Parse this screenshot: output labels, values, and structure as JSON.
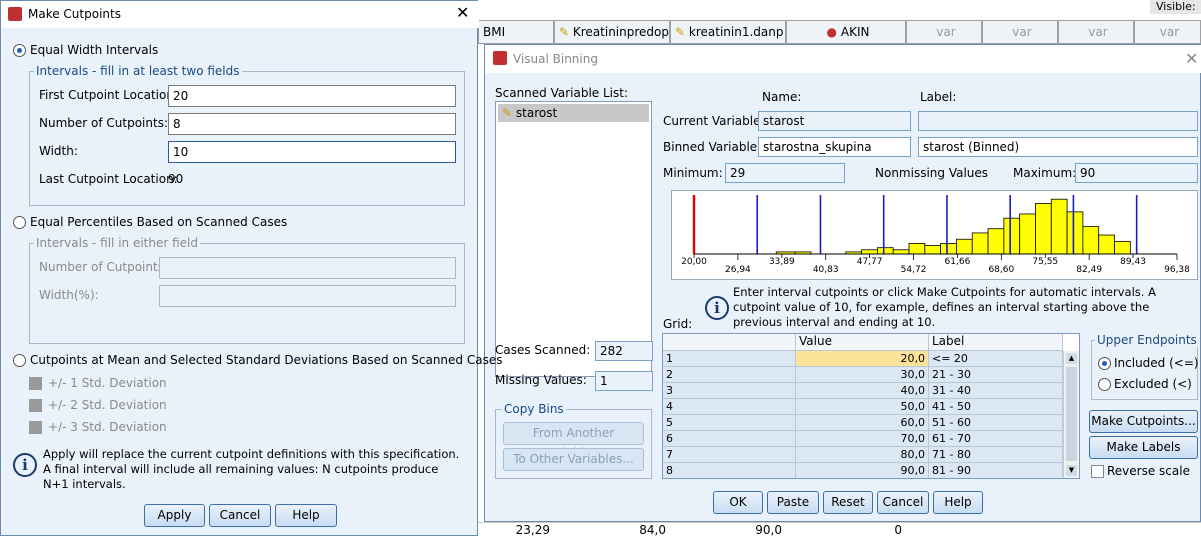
{
  "background": {
    "visible_label": "Visible:",
    "columns": [
      "BMI",
      "Kreatininpredop",
      "kreatinin1.danp",
      "AKIN",
      "var",
      "var",
      "var",
      "var"
    ],
    "bottom_row": [
      "23,29",
      "84,0",
      "90,0",
      "0"
    ]
  },
  "make_cutpoints": {
    "title": "Make Cutpoints",
    "equal_width": {
      "label": "Equal Width Intervals",
      "group_title": "Intervals - fill in at least two fields",
      "first_label": "First Cutpoint Location:",
      "first_value": "20",
      "number_label": "Number of Cutpoints:",
      "number_value": "8",
      "width_label": "Width:",
      "width_value": "10",
      "last_label": "Last Cutpoint Location:",
      "last_value": "90"
    },
    "equal_percentiles": {
      "label": "Equal Percentiles Based on Scanned Cases",
      "group_title": "Intervals - fill in either field",
      "number_label": "Number of Cutpoints:",
      "width_label": "Width(%):"
    },
    "mean_sd": {
      "label": "Cutpoints at Mean and Selected Standard Deviations Based on Scanned Cases",
      "sd1": "+/- 1 Std. Deviation",
      "sd2": "+/- 2 Std. Deviation",
      "sd3": "+/- 3 Std. Deviation"
    },
    "info_text": "Apply will replace the current cutpoint definitions with this specification. A final interval will include all remaining values: N cutpoints produce N+1 intervals.",
    "buttons": {
      "apply": "Apply",
      "cancel": "Cancel",
      "help": "Help"
    }
  },
  "visual_binning": {
    "title": "Visual Binning",
    "scanned_list_label": "Scanned Variable List:",
    "scanned_item": "starost",
    "name_label": "Name:",
    "label_label": "Label:",
    "current_variable_label": "Current Variable:",
    "current_variable_value": "starost",
    "current_variable_desc": "",
    "binned_variable_label": "Binned Variable:",
    "binned_variable_value": "starostna_skupina",
    "binned_variable_desc": "starost (Binned)",
    "minimum_label": "Minimum:",
    "minimum_value": "29",
    "nonmissing_label": "Nonmissing Values",
    "maximum_label": "Maximum:",
    "maximum_value": "90",
    "cases_scanned_label": "Cases Scanned:",
    "cases_scanned_value": "282",
    "missing_values_label": "Missing Values:",
    "missing_values_value": "1",
    "copy_bins_label": "Copy Bins",
    "from_another_label": "From Another Variable...",
    "to_other_label": "To Other Variables...",
    "info_text": "Enter interval cutpoints or click Make Cutpoints for automatic intervals. A cutpoint value of 10, for example, defines an interval starting above the previous interval and ending at 10.",
    "grid_label": "Grid:",
    "grid_headers": [
      "",
      "Value",
      "Label"
    ],
    "grid_rows": [
      [
        "1",
        "20,0",
        "<= 20"
      ],
      [
        "2",
        "30,0",
        "21 - 30"
      ],
      [
        "3",
        "40,0",
        "31 - 40"
      ],
      [
        "4",
        "50,0",
        "41 - 50"
      ],
      [
        "5",
        "60,0",
        "51 - 60"
      ],
      [
        "6",
        "70,0",
        "61 - 70"
      ],
      [
        "7",
        "80,0",
        "71 - 80"
      ],
      [
        "8",
        "90,0",
        "81 - 90"
      ]
    ],
    "upper_endpoints_label": "Upper Endpoints",
    "included_label": "Included (<=)",
    "excluded_label": "Excluded (<)",
    "make_cutpoints_button": "Make Cutpoints...",
    "make_labels_button": "Make Labels",
    "reverse_scale_label": "Reverse scale",
    "buttons": {
      "ok": "OK",
      "paste": "Paste",
      "reset": "Reset",
      "cancel": "Cancel",
      "help": "Help"
    }
  },
  "chart_data": {
    "type": "bar",
    "xlim": [
      20,
      96.38
    ],
    "tick_labels_upper": [
      "20,00",
      "33,89",
      "47,77",
      "61,66",
      "75,55",
      "89,43"
    ],
    "tick_labels_lower": [
      "26,94",
      "40,83",
      "54,72",
      "68,60",
      "82,49",
      "96,38"
    ],
    "ticks_upper": [
      20.0,
      33.89,
      47.77,
      61.66,
      75.55,
      89.43
    ],
    "ticks_lower": [
      26.94,
      40.83,
      54.72,
      68.6,
      82.49,
      96.38
    ],
    "bin_edges": [
      33.0,
      36.0,
      38.5,
      41.5,
      44.0,
      46.5,
      49.0,
      51.5,
      54.0,
      56.5,
      59.0,
      61.5,
      64.0,
      66.5,
      69.0,
      71.5,
      74.0,
      76.5,
      79.0,
      81.5,
      84.0,
      86.5,
      89.0
    ],
    "counts": [
      1,
      1,
      0,
      0,
      1,
      2,
      3,
      2,
      5,
      4,
      5,
      7,
      10,
      12,
      17,
      19,
      24,
      26,
      20,
      13,
      9,
      6
    ],
    "ymax": 28,
    "cutpoints": [
      20,
      30,
      40,
      50,
      60,
      70,
      80,
      90
    ],
    "first_cutpoint_color": "#e00000",
    "cutpoint_color": "#1a1ad0",
    "bar_color": "#ffff00"
  }
}
